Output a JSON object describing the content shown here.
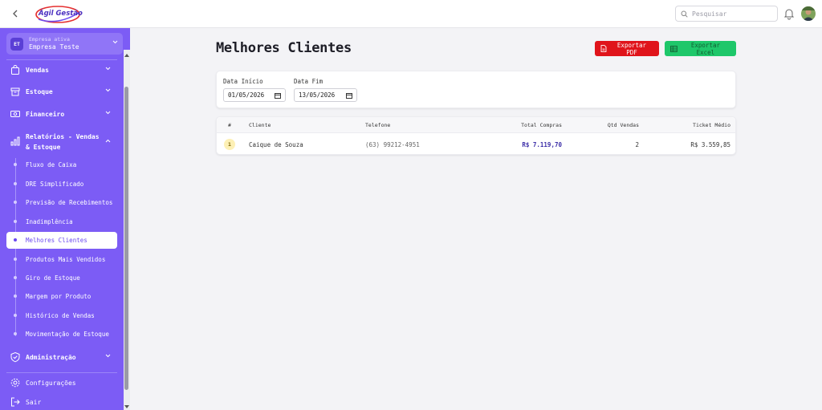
{
  "app": {
    "logo_text": "Ágil Gestão",
    "search_placeholder": "Pesquisar"
  },
  "company": {
    "badge": "ET",
    "label": "Empresa ativa",
    "name": "Empresa Teste"
  },
  "sidebar": {
    "items": [
      {
        "label": "Vendas",
        "icon": "shopping-bag-icon"
      },
      {
        "label": "Estoque",
        "icon": "box-icon"
      },
      {
        "label": "Financeiro",
        "icon": "money-icon"
      },
      {
        "label": "Relatórios - Vendas & Estoque",
        "icon": "bar-chart-icon"
      }
    ],
    "reports": [
      "Fluxo de Caixa",
      "DRE Simplificado",
      "Previsão de Recebimentos",
      "Inadimplência",
      "Melhores Clientes",
      "Produtos Mais Vendidos",
      "Giro de Estoque",
      "Margem por Produto",
      "Histórico de Vendas",
      "Movimentação de Estoque"
    ],
    "active_report": "Melhores Clientes",
    "admin": {
      "label": "Administração",
      "icon": "shield-icon"
    },
    "settings": {
      "label": "Configurações",
      "icon": "gear-icon"
    },
    "logout": {
      "label": "Sair",
      "icon": "logout-icon"
    }
  },
  "page": {
    "title": "Melhores Clientes",
    "export_pdf": "Exportar PDF",
    "export_excel": "Exportar Excel"
  },
  "filters": {
    "start_label": "Data Início",
    "start_value": "01/05/2026",
    "end_label": "Data Fim",
    "end_value": "13/05/2026"
  },
  "table": {
    "headers": {
      "rank": "#",
      "client": "Cliente",
      "phone": "Telefone",
      "total": "Total Compras",
      "qty": "Qtd Vendas",
      "ticket": "Ticket Médio"
    },
    "rows": [
      {
        "rank": "1",
        "client": "Caique de Souza",
        "phone": "(63) 99212-4951",
        "total": "R$ 7.119,70",
        "qty": "2",
        "ticket": "R$ 3.559,85"
      }
    ]
  },
  "colors": {
    "sidebar": "#7c5cf5",
    "pdf": "#e0141b",
    "excel": "#1ec76a",
    "accent": "#6b48f0"
  }
}
